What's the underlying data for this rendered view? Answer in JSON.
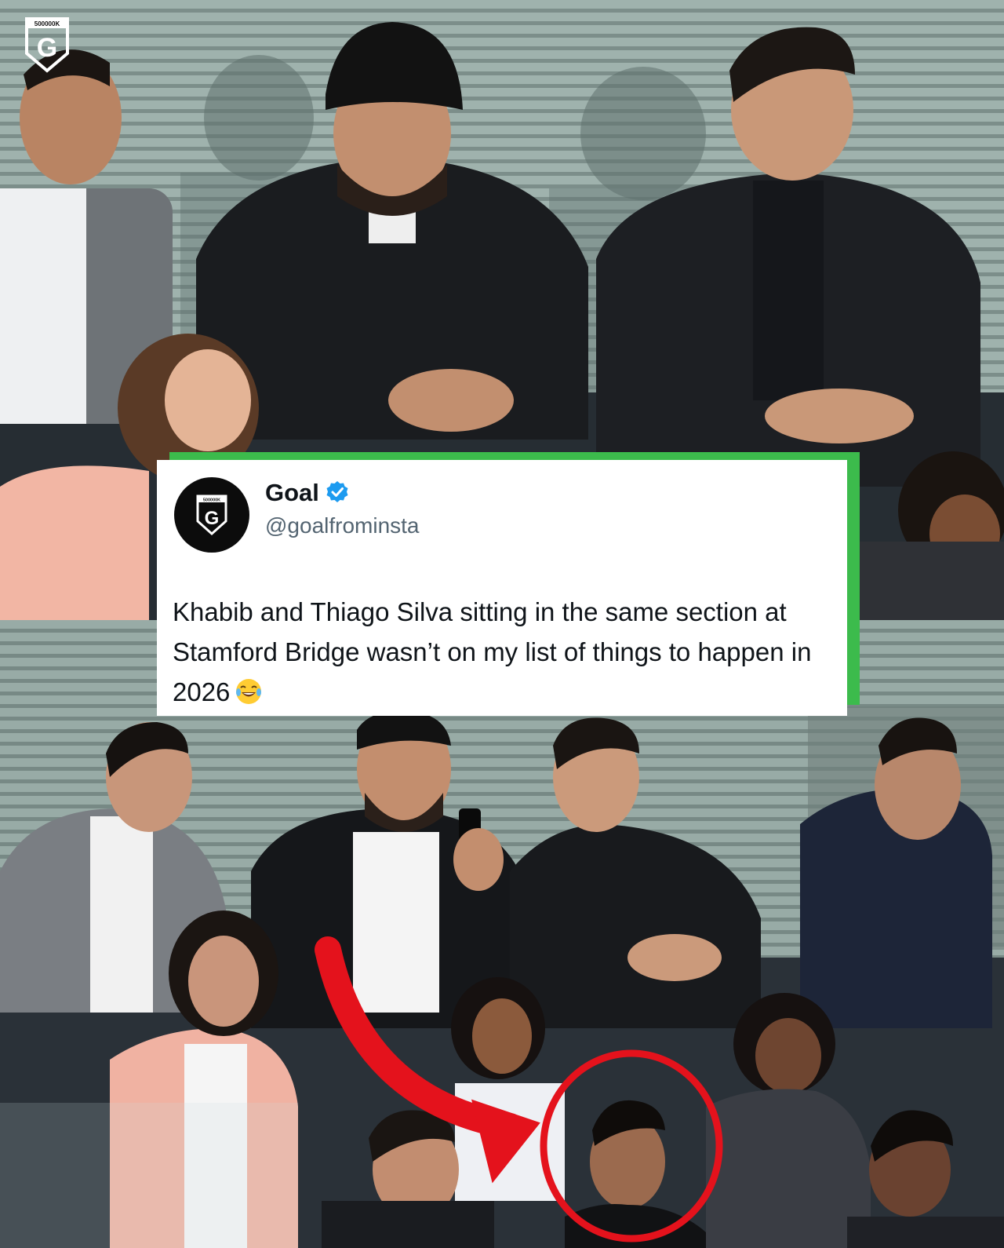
{
  "tweet": {
    "name": "Goal",
    "handle": "@goalfrominsta",
    "text": "Khabib and Thiago Silva sitting in the same section at Stamford Bridge wasn’t on my list of things to happen in 2026",
    "emoji": "face-with-tears-of-joy",
    "verified": true
  },
  "brand": {
    "logo_letter": "G",
    "logo_top_text": "500000K",
    "avatar_top_text": "500000K"
  },
  "colors": {
    "tweet_accent": "#3cbb4c",
    "verified_blue": "#1d9bf0",
    "highlight_red": "#e4121c"
  }
}
